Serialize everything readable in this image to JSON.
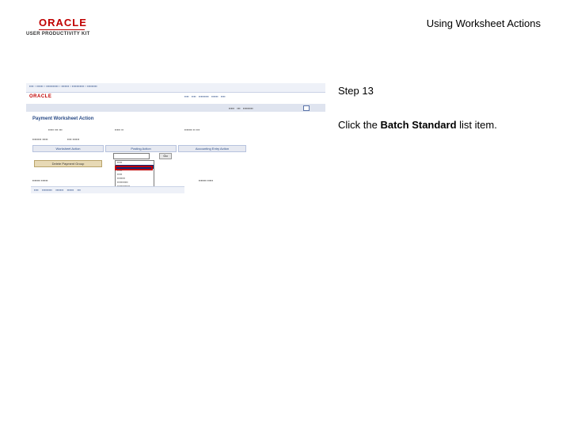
{
  "header": {
    "logo_text": "ORACLE",
    "logo_subtitle": "USER PRODUCTIVITY KIT",
    "title": "Using Worksheet Actions"
  },
  "step": {
    "title": "Step 13",
    "instruction_prefix": "Click the ",
    "instruction_target": "Batch Standard",
    "instruction_suffix": " list item."
  },
  "thumbnail": {
    "logo": "ORACLE",
    "page_title": "Payment Worksheet Action",
    "section_headers": [
      "Worksheet Action",
      "Posting Action",
      "Accounting Entry Action"
    ],
    "button": "Delete Payment Group",
    "go_button": "Go"
  },
  "colors": {
    "brand_red": "#c00000",
    "link_blue": "#2a4b86",
    "highlight_navy": "#102a7a"
  }
}
